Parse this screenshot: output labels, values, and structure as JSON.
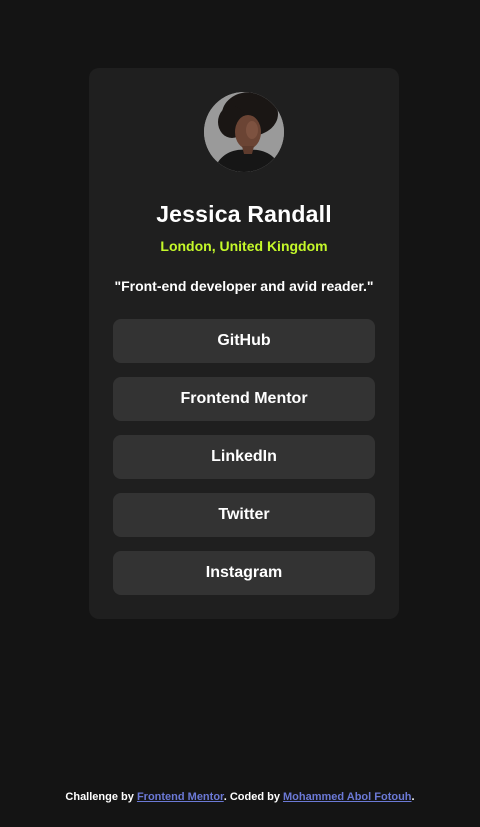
{
  "profile": {
    "name": "Jessica Randall",
    "location": "London, United Kingdom",
    "bio": "\"Front-end developer and avid reader.\"",
    "avatar_icon": "avatar-photo"
  },
  "links": [
    {
      "label": "GitHub"
    },
    {
      "label": "Frontend Mentor"
    },
    {
      "label": "LinkedIn"
    },
    {
      "label": "Twitter"
    },
    {
      "label": "Instagram"
    }
  ],
  "footer": {
    "prefix": "Challenge by ",
    "challenge_link": "Frontend Mentor",
    "middle": ". Coded by ",
    "author_link": "Mohammed Abol Fotouh",
    "suffix": "."
  },
  "colors": {
    "background": "#141414",
    "card": "#1f1f1f",
    "button": "#333333",
    "accent": "#c4f82a",
    "link": "#6b79d6"
  }
}
